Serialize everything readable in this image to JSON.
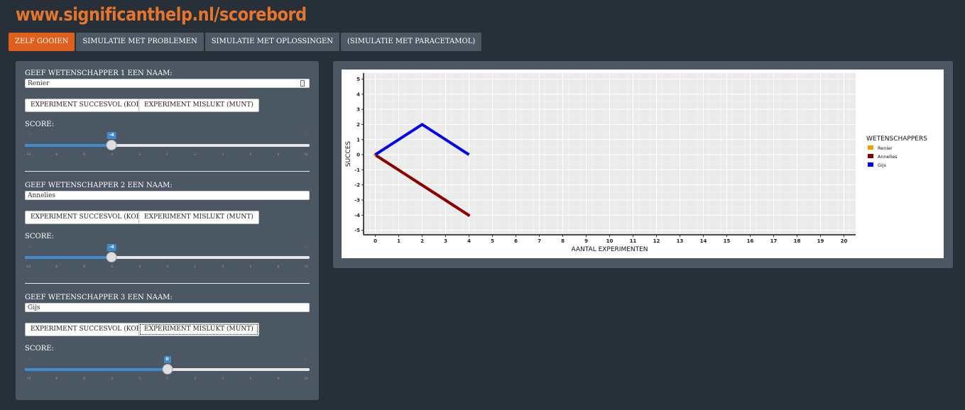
{
  "header": {
    "title": "www.significanthelp.nl/scorebord"
  },
  "tabs": [
    {
      "label": "ZELF GOOIEN",
      "active": true
    },
    {
      "label": "SIMULATIE MET PROBLEMEN",
      "active": false
    },
    {
      "label": "SIMULATIE MET OPLOSSINGEN",
      "active": false
    },
    {
      "label": "(SIMULATIE MET PARACETAMOL)",
      "active": false
    }
  ],
  "sidebar": {
    "scientists": [
      {
        "label": "GEEF WETENSCHAPPER 1 EEN NAAM:",
        "name": "Renier",
        "success_button": "EXPERIMENT SUCCESVOL (KOP)",
        "fail_button": "EXPERIMENT MISLUKT (MUNT)",
        "score_label": "SCORE:",
        "score": -4,
        "score_display": "-4"
      },
      {
        "label": "GEEF WETENSCHAPPER 2 EEN NAAM:",
        "name": "Annelies",
        "success_button": "EXPERIMENT SUCCESVOL (KOP)",
        "fail_button": "EXPERIMENT MISLUKT (MUNT)",
        "score_label": "SCORE:",
        "score": -4,
        "score_display": "-4"
      },
      {
        "label": "GEEF WETENSCHAPPER 3 EEN NAAM:",
        "name": "Gijs",
        "success_button": "EXPERIMENT SUCCESVOL (KOP)",
        "fail_button": "EXPERIMENT MISLUKT (MUNT)",
        "score_label": "SCORE:",
        "score": 0,
        "score_display": "0"
      }
    ],
    "slider": {
      "min": -10,
      "max": 10,
      "ticks": [
        "-10",
        "-8",
        "-6",
        "-4",
        "-2",
        "0",
        "2",
        "4",
        "6",
        "8",
        "10"
      ]
    }
  },
  "chart_data": {
    "type": "line",
    "xlabel": "AANTAL EXPERIMENTEN",
    "ylabel": "SUCCES",
    "xlim": [
      -0.5,
      20.5
    ],
    "ylim": [
      -5.3,
      5.4
    ],
    "x_ticks": [
      "0",
      "1",
      "2",
      "3",
      "4",
      "5",
      "6",
      "7",
      "8",
      "9",
      "10",
      "11",
      "12",
      "13",
      "14",
      "15",
      "16",
      "17",
      "18",
      "19",
      "20"
    ],
    "y_ticks": [
      "5",
      "4",
      "3",
      "2",
      "1",
      "0",
      "-1",
      "-2",
      "-3",
      "-4",
      "-5"
    ],
    "legend_title": "WETENSCHAPPERS",
    "legend_position": "right",
    "grid": true,
    "series": [
      {
        "name": "Renier",
        "color": "#f0a000",
        "x": [
          0,
          1,
          2,
          3,
          4
        ],
        "y": [
          0,
          -1,
          -2,
          -3,
          -4
        ]
      },
      {
        "name": "Annelies",
        "color": "#8b0000",
        "x": [
          0,
          1,
          2,
          3,
          4
        ],
        "y": [
          0,
          -1,
          -2,
          -3,
          -4
        ]
      },
      {
        "name": "Gijs",
        "color": "#0000ee",
        "x": [
          0,
          1,
          2,
          3,
          4
        ],
        "y": [
          0,
          1,
          2,
          1,
          0
        ]
      }
    ]
  }
}
